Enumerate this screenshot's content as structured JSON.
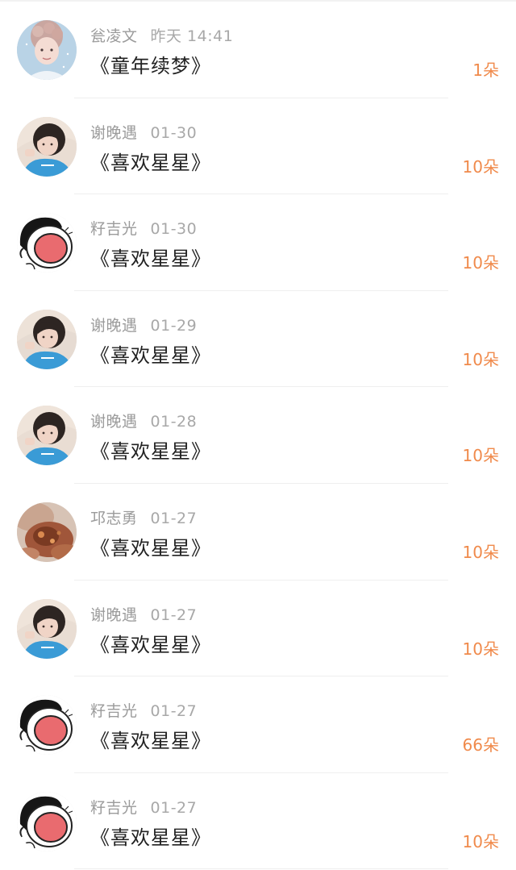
{
  "colors": {
    "amount": "#f08a4b",
    "meta": "#9b9b9b",
    "title": "#222222",
    "divider": "#efefef"
  },
  "gifts": [
    {
      "user": "瓮凌文",
      "date": "昨天 14:41",
      "title": "《童年续梦》",
      "amount": "1朵",
      "avatar": "boy-curly-avatar"
    },
    {
      "user": "谢晚遇",
      "date": "01-30",
      "title": "《喜欢星星》",
      "amount": "10朵",
      "avatar": "girl-blue-avatar"
    },
    {
      "user": "籽吉光",
      "date": "01-30",
      "title": "《喜欢星星》",
      "amount": "10朵",
      "avatar": "cartoon-shout-avatar"
    },
    {
      "user": "谢晚遇",
      "date": "01-29",
      "title": "《喜欢星星》",
      "amount": "10朵",
      "avatar": "girl-blue-avatar"
    },
    {
      "user": "谢晚遇",
      "date": "01-28",
      "title": "《喜欢星星》",
      "amount": "10朵",
      "avatar": "girl-blue-avatar"
    },
    {
      "user": "邛志勇",
      "date": "01-27",
      "title": "《喜欢星星》",
      "amount": "10朵",
      "avatar": "food-brown-avatar"
    },
    {
      "user": "谢晚遇",
      "date": "01-27",
      "title": "《喜欢星星》",
      "amount": "10朵",
      "avatar": "girl-blue-avatar"
    },
    {
      "user": "籽吉光",
      "date": "01-27",
      "title": "《喜欢星星》",
      "amount": "66朵",
      "avatar": "cartoon-shout-avatar"
    },
    {
      "user": "籽吉光",
      "date": "01-27",
      "title": "《喜欢星星》",
      "amount": "10朵",
      "avatar": "cartoon-shout-avatar"
    }
  ]
}
